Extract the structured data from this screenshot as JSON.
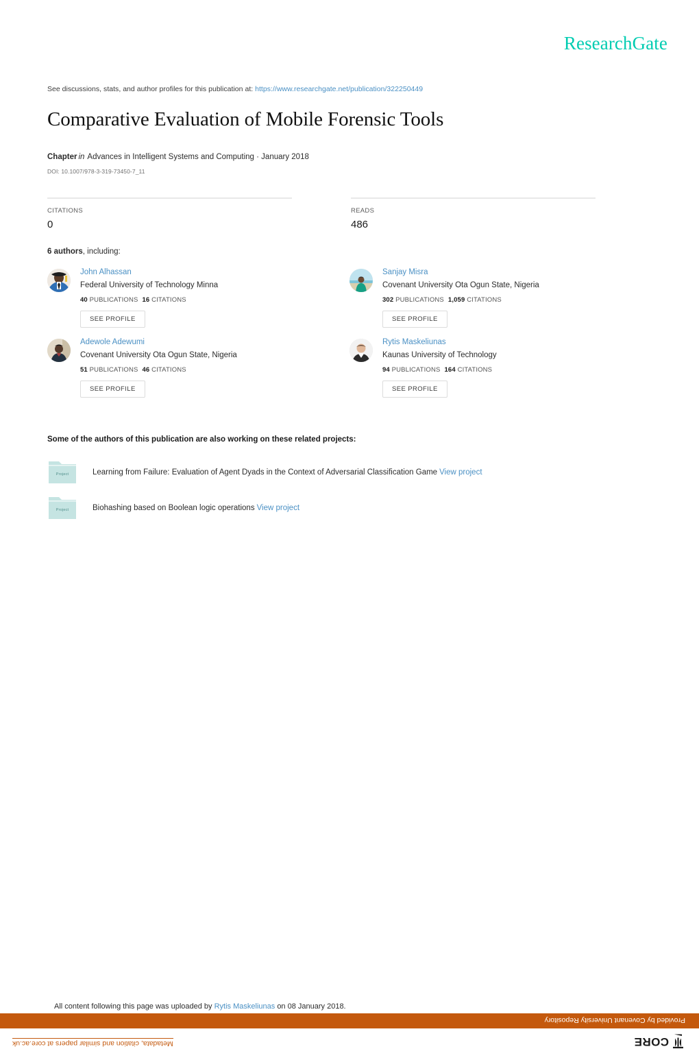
{
  "brand": {
    "logo": "ResearchGate",
    "accent_color": "#00ccb1"
  },
  "header": {
    "discussions_prefix": "See discussions, stats, and author profiles for this publication at:",
    "publication_url": "https://www.researchgate.net/publication/322250449"
  },
  "publication": {
    "title": "Comparative Evaluation of Mobile Forensic Tools",
    "type": "Chapter",
    "in_word": "in",
    "venue": "Advances in Intelligent Systems and Computing · January 2018",
    "doi": "DOI: 10.1007/978-3-319-73450-7_11"
  },
  "metrics": {
    "citations_label": "CITATIONS",
    "citations_value": "0",
    "reads_label": "READS",
    "reads_value": "486"
  },
  "authors_section": {
    "heading_count": "6 authors",
    "heading_rest": ", including:",
    "see_profile_label": "SEE PROFILE",
    "publications_word": "PUBLICATIONS",
    "citations_word": "CITATIONS",
    "authors": [
      {
        "name": "John Alhassan",
        "affiliation": "Federal University of Technology Minna",
        "publications": "40",
        "citations": "16"
      },
      {
        "name": "Sanjay Misra",
        "affiliation": "Covenant University Ota Ogun State, Nigeria",
        "publications": "302",
        "citations": "1,059"
      },
      {
        "name": "Adewole Adewumi",
        "affiliation": "Covenant University Ota Ogun State, Nigeria",
        "publications": "51",
        "citations": "46"
      },
      {
        "name": "Rytis Maskeliunas",
        "affiliation": "Kaunas University of Technology",
        "publications": "94",
        "citations": "164"
      }
    ]
  },
  "projects_section": {
    "heading": "Some of the authors of this publication are also working on these related projects:",
    "folder_label": "Project",
    "view_project_label": "View project",
    "projects": [
      {
        "title": "Learning from Failure: Evaluation of Agent Dyads in the Context of Adversarial Classification Game"
      },
      {
        "title": "Biohashing based on Boolean logic operations"
      }
    ]
  },
  "footer": {
    "upload_prefix": "All content following this page was uploaded by",
    "uploader": "Rytis Maskeliunas",
    "upload_suffix": "on 08 January 2018.",
    "core_provided_by": "Provided by Covenant University Repository",
    "core_metadata_text": "Metadata, citation and similar papers at core.ac.uk",
    "core_logo_text": "CORE",
    "core_banner_color": "#c4590d"
  }
}
